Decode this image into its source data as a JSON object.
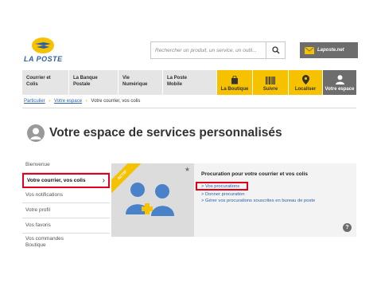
{
  "logo": {
    "text": "LA POSTE"
  },
  "search": {
    "placeholder": "Rechercher un produit, un service, un outil..."
  },
  "header": {
    "webmail_label": "Laposte.net"
  },
  "nav": {
    "items": [
      {
        "label": "Courrier et\nColis"
      },
      {
        "label": "La Banque\nPostale"
      },
      {
        "label": "Vie\nNumérique"
      },
      {
        "label": "La Poste\nMobile"
      }
    ],
    "yellow_items": [
      {
        "label": "La Boutique",
        "icon": "shopping-bag-icon"
      },
      {
        "label": "Suivre",
        "icon": "barcode-icon"
      },
      {
        "label": "Localiser",
        "icon": "location-pin-icon"
      }
    ],
    "account": {
      "label": "Votre espace",
      "icon": "user-icon"
    }
  },
  "breadcrumb": {
    "items": [
      "Particulier",
      "Votre espace",
      "Votre courrier, vos colis"
    ]
  },
  "page": {
    "title": "Votre espace de services personnalisés"
  },
  "sidebar": {
    "items": [
      {
        "label": "Bienvenue"
      },
      {
        "label": "Votre courrier, vos colis"
      },
      {
        "label": "Vos notifications"
      },
      {
        "label": "Votre profil"
      },
      {
        "label": "Vos favoris"
      },
      {
        "label": "Vos commandes\nBoutique"
      }
    ]
  },
  "card": {
    "badge": "ACTIF",
    "title": "Procuration pour votre courrier et vos colis",
    "links": [
      "> Vos procurations",
      "> Donner procuration",
      "> Gérer vos procurations souscrites en bureau de poste"
    ],
    "help": "?"
  },
  "colors": {
    "brand_yellow": "#f6c200",
    "brand_blue": "#2b5fa8",
    "highlight_red": "#e3001b",
    "nav_grey": "#6d6d6d"
  }
}
